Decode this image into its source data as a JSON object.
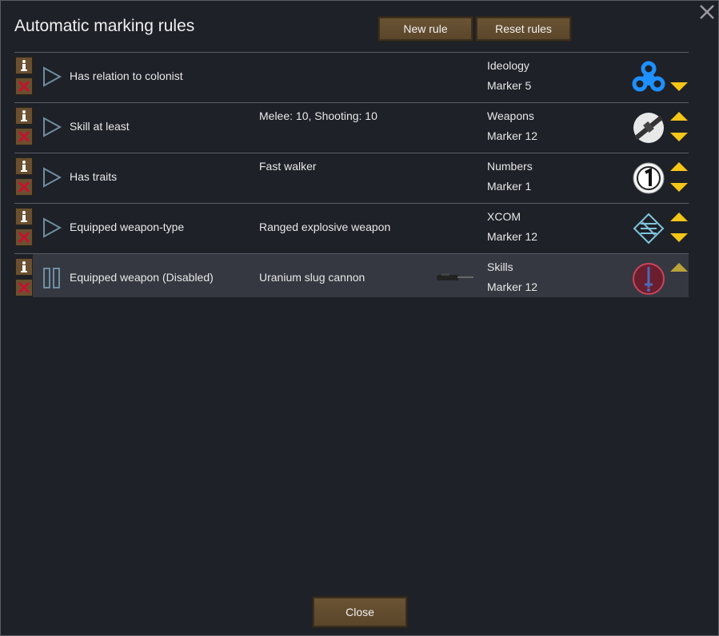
{
  "dialog": {
    "title": "Automatic marking rules",
    "new_rule_label": "New rule",
    "reset_rules_label": "Reset rules",
    "close_label": "Close",
    "close_icon": "close-x-icon"
  },
  "colors": {
    "background": "#1e2127",
    "button": "#6b5435",
    "arrow": "#f5c518",
    "play": "#6f8da3",
    "delete": "#c8102e"
  },
  "rules": [
    {
      "name": "Has relation to colonist",
      "param": "",
      "category": "Ideology",
      "marker": "Marker 5",
      "icon": "ideology-icon",
      "enabled": true,
      "can_move_up": false,
      "can_move_down": true
    },
    {
      "name": "Skill at least",
      "param": "Melee: 10, Shooting: 10",
      "category": "Weapons",
      "marker": "Marker 12",
      "icon": "rifle-icon",
      "enabled": true,
      "can_move_up": true,
      "can_move_down": true
    },
    {
      "name": "Has traits",
      "param": "Fast walker",
      "category": "Numbers",
      "marker": "Marker 1",
      "icon": "number-one-icon",
      "enabled": true,
      "can_move_up": true,
      "can_move_down": true
    },
    {
      "name": "Equipped weapon-type",
      "param": "Ranged explosive weapon",
      "category": "XCOM",
      "marker": "Marker 12",
      "icon": "xcom-icon",
      "enabled": true,
      "can_move_up": true,
      "can_move_down": true
    },
    {
      "name": "Equipped weapon (Disabled)",
      "param": "Uranium slug cannon",
      "category": "Skills",
      "marker": "Marker 12",
      "icon": "sword-skill-icon",
      "weapon_icon": "uranium-slug-cannon-icon",
      "enabled": false,
      "can_move_up": true,
      "can_move_down": false
    }
  ]
}
